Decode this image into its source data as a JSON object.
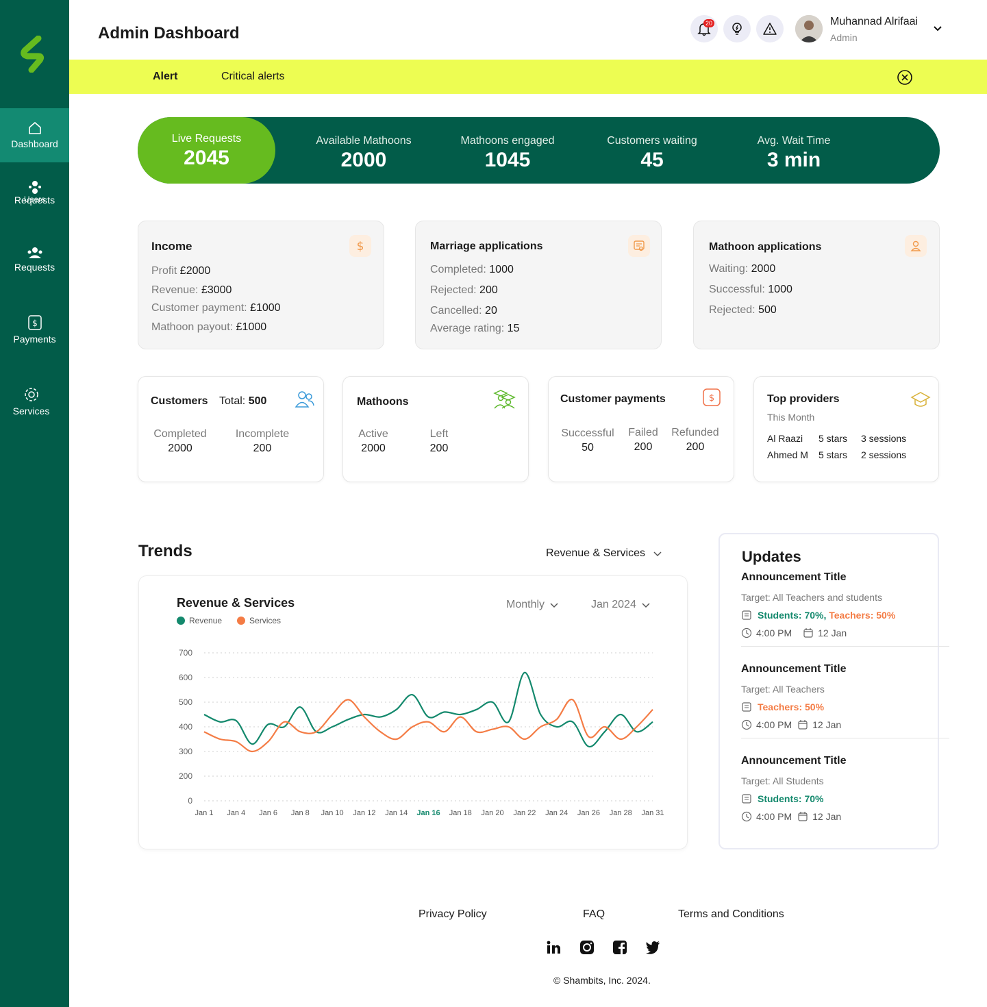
{
  "header": {
    "title": "Admin Dashboard",
    "notification_count": "20",
    "user_name": "Muhannad Alrifaai",
    "user_role": "Admin"
  },
  "sidebar": {
    "items": [
      {
        "label": "Dashboard",
        "icon": "home-icon"
      },
      {
        "label": "Users",
        "icon": "users-icon"
      },
      {
        "label": "Requests",
        "icon": "requests-icon"
      },
      {
        "label": "Requests",
        "icon": "requests-icon"
      },
      {
        "label": "Payments",
        "icon": "payments-icon"
      },
      {
        "label": "Services",
        "icon": "gear-icon"
      }
    ]
  },
  "alert": {
    "label": "Alert",
    "text": "Critical alerts"
  },
  "stats": {
    "live": {
      "label": "Live Requests",
      "value": "2045"
    },
    "items": [
      {
        "label": "Available Mathoons",
        "value": "2000"
      },
      {
        "label": "Mathoons engaged",
        "value": "1045"
      },
      {
        "label": "Customers waiting",
        "value": "45"
      },
      {
        "label": "Avg. Wait Time",
        "value": "3 min"
      }
    ]
  },
  "income": {
    "title": "Income",
    "rows": [
      {
        "label": "Profit ",
        "value": "£2000"
      },
      {
        "label": "Revenue: ",
        "value": "£3000"
      },
      {
        "label": "Customer payment: ",
        "value": "£1000"
      },
      {
        "label": "Mathoon payout: ",
        "value": "£1000"
      }
    ]
  },
  "marriage": {
    "title": "Marriage applications",
    "rows": [
      {
        "label": "Completed: ",
        "value": "1000"
      },
      {
        "label": "Rejected: ",
        "value": "200"
      },
      {
        "label": "Cancelled: ",
        "value": "20"
      },
      {
        "label": "Average rating: ",
        "value": "15"
      }
    ]
  },
  "mathoon_apps": {
    "title": "Mathoon applications",
    "rows": [
      {
        "label": "Waiting: ",
        "value": "2000"
      },
      {
        "label": "Successful: ",
        "value": "1000"
      },
      {
        "label": "Rejected: ",
        "value": "500"
      }
    ]
  },
  "customers": {
    "title": "Customers",
    "total_label": "Total: ",
    "total": "500",
    "completed_label": "Completed",
    "completed": "2000",
    "incomplete_label": "Incomplete",
    "incomplete": "200"
  },
  "mathoons": {
    "title": "Mathoons",
    "active_label": "Active",
    "active": "2000",
    "left_label": "Left",
    "left": "200"
  },
  "payments": {
    "title": "Customer payments",
    "successful_label": "Successful",
    "successful": "50",
    "failed_label": "Failed",
    "failed": "200",
    "refunded_label": "Refunded",
    "refunded": "200"
  },
  "providers": {
    "title": "Top providers",
    "subtitle": "This Month",
    "rows": [
      {
        "name": "Al Raazi",
        "stars": "5 stars",
        "sessions": "3 sessions"
      },
      {
        "name": "Ahmed M",
        "stars": "5 stars",
        "sessions": "2 sessions"
      }
    ]
  },
  "trends": {
    "title": "Trends",
    "selector": "Revenue & Services",
    "period": "Monthly",
    "month": "Jan 2024"
  },
  "chart_data": {
    "type": "line",
    "title": "Revenue & Services",
    "ylim": [
      0,
      700
    ],
    "yticks": [
      0,
      200,
      300,
      400,
      500,
      600,
      700
    ],
    "xticks": [
      "Jan 1",
      "Jan 4",
      "Jan 6",
      "Jan 8",
      "Jan 10",
      "Jan 12",
      "Jan 14",
      "Jan 16",
      "Jan 18",
      "Jan 20",
      "Jan 22",
      "Jan 24",
      "Jan 26",
      "Jan 28",
      "Jan 31"
    ],
    "highlight": "Jan 16",
    "colors": {
      "Revenue": "#14896d",
      "Services": "#f47c45"
    },
    "series": [
      {
        "name": "Revenue",
        "values": [
          450,
          420,
          425,
          330,
          410,
          400,
          480,
          380,
          400,
          430,
          450,
          440,
          470,
          530,
          440,
          460,
          450,
          470,
          500,
          420,
          620,
          450,
          400,
          420,
          320,
          380,
          450,
          380,
          420
        ]
      },
      {
        "name": "Services",
        "values": [
          380,
          350,
          340,
          300,
          340,
          420,
          380,
          380,
          450,
          510,
          440,
          380,
          350,
          400,
          420,
          380,
          440,
          380,
          390,
          400,
          350,
          400,
          430,
          510,
          360,
          400,
          350,
          400,
          470
        ]
      }
    ]
  },
  "updates": {
    "title": "Updates",
    "items": [
      {
        "title": "Announcement Title",
        "target": "Target: All Teachers and students",
        "p1": "Students: 70%,",
        "p2": " Teachers: 50%",
        "time": "4:00 PM",
        "date": "12 Jan"
      },
      {
        "title": "Announcement Title",
        "target": "Target: All Teachers",
        "p1": "",
        "p2": "Teachers: 50%",
        "time": "4:00 PM",
        "date": "12 Jan"
      },
      {
        "title": "Announcement Title",
        "target": "Target: All Students",
        "p1": "Students: 70%",
        "p2": "",
        "time": "4:00 PM",
        "date": "12 Jan"
      }
    ]
  },
  "footer": {
    "links": [
      "Privacy Policy",
      "FAQ",
      "Terms and Conditions"
    ],
    "copyright": "© Shambits, Inc. 2024."
  }
}
